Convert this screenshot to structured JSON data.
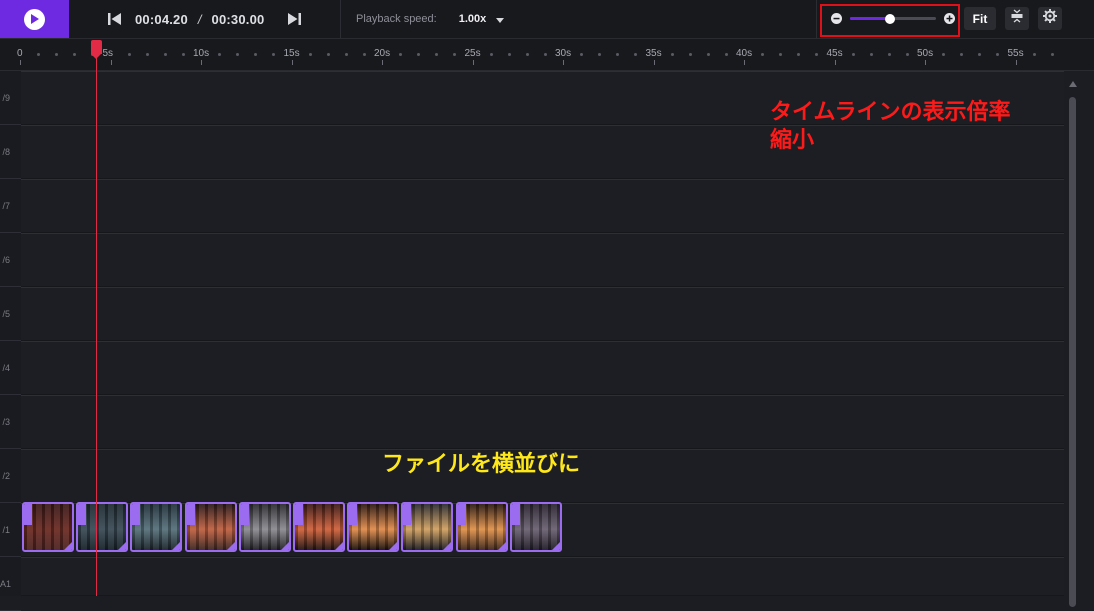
{
  "transport": {
    "current_time": "00:04.20",
    "separator": "/",
    "total_time": "00:30.00"
  },
  "playback": {
    "label": "Playback speed:",
    "value": "1.00x"
  },
  "zoom": {
    "level_fraction": 0.47,
    "fit_label": "Fit"
  },
  "ruler": {
    "labels": [
      "0",
      "5s",
      "10s",
      "15s",
      "20s",
      "25s",
      "30s",
      "35s",
      "40s",
      "45s",
      "50s",
      "55s"
    ]
  },
  "playhead": {
    "time_seconds": 4.2
  },
  "tracks": {
    "labels": [
      "/9",
      "/8",
      "/7",
      "/6",
      "/5",
      "/4",
      "/3",
      "/2",
      "/1",
      "A1"
    ]
  },
  "clips": [
    {
      "palette": [
        "#3a1a1a",
        "#6b2a22",
        "#4a2220"
      ]
    },
    {
      "palette": [
        "#1e2a30",
        "#3a4a55",
        "#152026"
      ]
    },
    {
      "palette": [
        "#22303a",
        "#56707a",
        "#1a2228"
      ]
    },
    {
      "palette": [
        "#2a1a1a",
        "#c06040",
        "#3a2420"
      ]
    },
    {
      "palette": [
        "#2a2a2e",
        "#8a8a90",
        "#1e1e22"
      ]
    },
    {
      "palette": [
        "#3a1a16",
        "#d0603a",
        "#1e1210"
      ]
    },
    {
      "palette": [
        "#2a1812",
        "#e08a4a",
        "#160e0a"
      ]
    },
    {
      "palette": [
        "#2a2a30",
        "#d0a060",
        "#1a1a20"
      ]
    },
    {
      "palette": [
        "#2a1a12",
        "#e0904a",
        "#3a2418"
      ]
    },
    {
      "palette": [
        "#2a2430",
        "#6a6070",
        "#1e1a24"
      ]
    }
  ],
  "annotations": {
    "zoom_note_line1": "タイムラインの表示倍率",
    "zoom_note_line2": "縮小",
    "clips_note": "ファイルを横並びに"
  },
  "colors": {
    "accent": "#6d2ae0",
    "playhead": "#e02a46",
    "clip_border": "#9b6cf0",
    "annotation_red": "#ff1a1a",
    "annotation_yellow": "#ffe81a"
  }
}
